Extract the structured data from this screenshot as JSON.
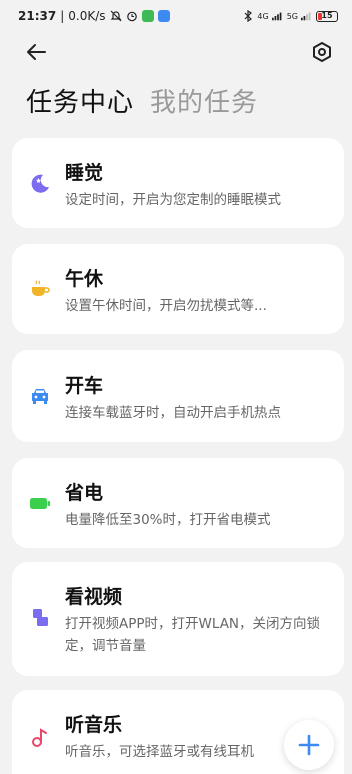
{
  "status_bar": {
    "time": "21:37",
    "speed": "0.0K/s",
    "network_a": "4G",
    "network_b": "5G",
    "battery": "15",
    "icons": [
      "mute-bell-icon",
      "alarm-icon",
      "app-green-icon",
      "app-blue-icon",
      "bluetooth-icon",
      "signal-icon",
      "signal-icon"
    ]
  },
  "toolbar": {
    "back_icon": "arrow-left-icon",
    "settings_icon": "hexagon-settings-icon"
  },
  "tabs": [
    {
      "label": "任务中心",
      "active": true
    },
    {
      "label": "我的任务",
      "active": false
    }
  ],
  "cards": [
    {
      "title": "睡觉",
      "desc": "设定时间，开启为您定制的睡眠模式",
      "icon": "moon-icon",
      "color": "#7b6cf0"
    },
    {
      "title": "午休",
      "desc": "设置午休时间，开启勿扰模式等...",
      "icon": "coffee-icon",
      "color": "#f0b429"
    },
    {
      "title": "开车",
      "desc": "连接车载蓝牙时，自动开启手机热点",
      "icon": "car-icon",
      "color": "#3d8bf2"
    },
    {
      "title": "省电",
      "desc": "电量降低至30%时，打开省电模式",
      "icon": "battery-icon",
      "color": "#3ccf4e"
    },
    {
      "title": "看视频",
      "desc": "打开视频APP时，打开WLAN，关闭方向锁定，调节音量",
      "icon": "video-icon",
      "color": "#7b6cf0"
    },
    {
      "title": "听音乐",
      "desc": "听音乐，可选择蓝牙或有线耳机",
      "icon": "music-icon",
      "color": "#e8476a"
    }
  ],
  "fab": {
    "icon": "plus-icon",
    "color": "#3d8bf2"
  }
}
